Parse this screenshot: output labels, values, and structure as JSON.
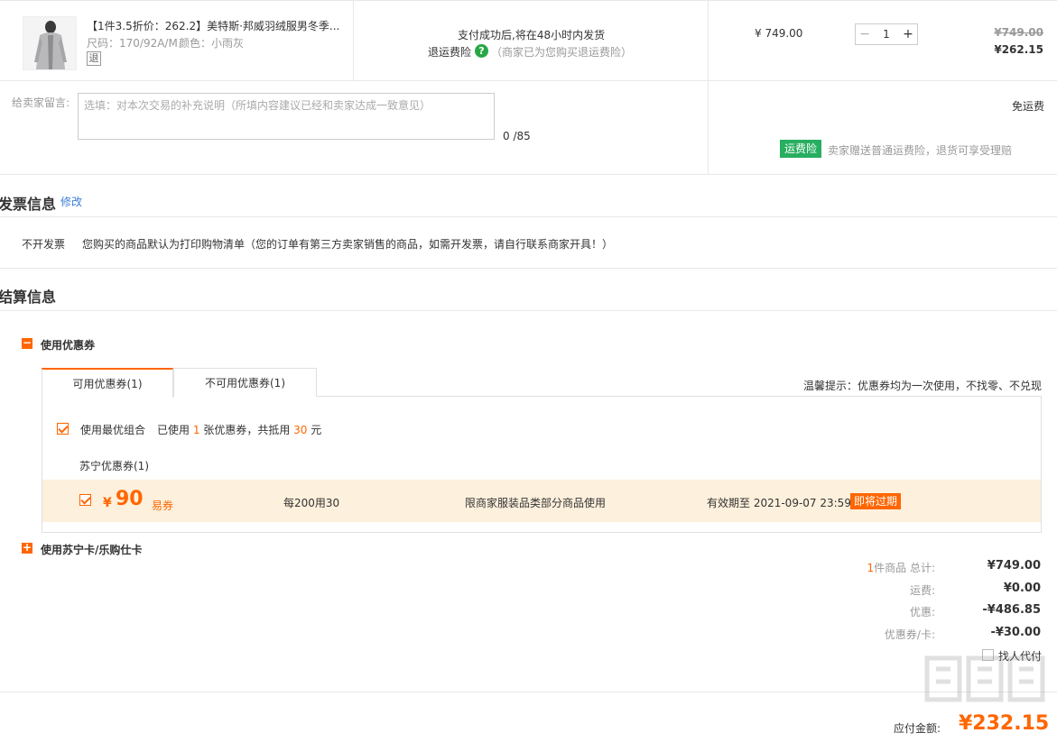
{
  "product": {
    "title": "【1件3.5折价：262.2】美特斯·邦威羽绒服男冬季...",
    "size": "尺码：170/92A/M",
    "color": "颜色：小雨灰",
    "return_badge": "退",
    "shipping_note": "支付成功后,将在48小时内发货",
    "insurance_label": "退运费险",
    "insurance_note": "（商家已为您购买退运费险）",
    "unit_price": "¥ 749.00",
    "quantity": "1",
    "qty_minus": "−",
    "qty_plus": "+",
    "original_price": "¥749.00",
    "final_price": "¥262.15"
  },
  "message": {
    "label": "给卖家留言:",
    "placeholder": "选填：对本次交易的补充说明（所填内容建议已经和卖家达成一致意见）",
    "counter": "0 /85",
    "free_shipping": "免运费",
    "insurance_tag": "运费险",
    "insurance_desc": "卖家赠送普通运费险，退货可享受理赔"
  },
  "invoice": {
    "title": "发票信息",
    "edit_link": "修改",
    "type": "不开发票",
    "desc": "您购买的商品默认为打印购物清单（您的订单有第三方卖家销售的商品，如需开发票，请自行联系商家开具！）"
  },
  "settlement": {
    "title": "结算信息",
    "coupon_section": "使用优惠券",
    "coupon_toggle": "−",
    "tab_available": "可用优惠券(1)",
    "tab_unavailable": "不可用优惠券(1)",
    "tip": "温馨提示：优惠券均为一次使用，不找零、不兑现",
    "best_combo": "使用最优组合",
    "used_prefix": "已使用",
    "used_count": "1",
    "used_mid": "张优惠券，共抵用",
    "used_amount": "30",
    "used_suffix": "元",
    "group_title": "苏宁优惠券(1)",
    "coupon": {
      "currency": "¥",
      "amount": "90",
      "type": "易券",
      "rule": "每200用30",
      "scope": "限商家服装品类部分商品使用",
      "validity": "有效期至 2021-09-07 23:59",
      "expire_tag": "即将过期"
    },
    "card_section": "使用苏宁卡/乐购仕卡",
    "card_toggle": "+"
  },
  "summary": {
    "count": "1",
    "total_label": "件商品 总计:",
    "total": "¥749.00",
    "shipping_label": "运费:",
    "shipping": "¥0.00",
    "discount_label": "优惠:",
    "discount": "-¥486.85",
    "coupon_label": "优惠券/卡:",
    "coupon": "-¥30.00",
    "proxy_pay": "找人代付",
    "payable_label": "应付金额:",
    "payable": "¥232.15"
  },
  "colors": {
    "accent": "#ff6600",
    "green": "#27ae60",
    "coupon_bg": "#fdf0dc"
  }
}
